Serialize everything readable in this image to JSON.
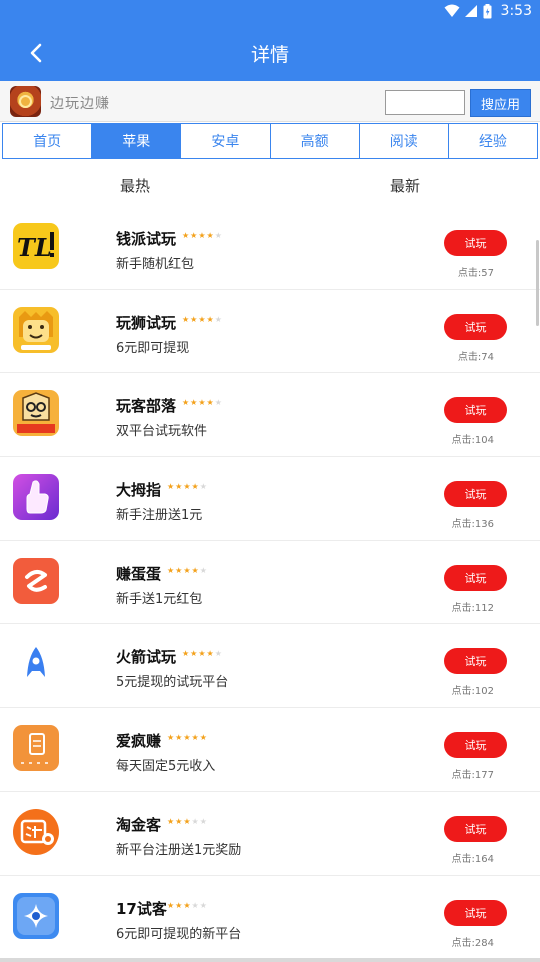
{
  "status_bar": {
    "time": "3:53"
  },
  "header": {
    "title": "详情"
  },
  "search": {
    "brand_text": "边玩边赚",
    "input_value": "",
    "button_label": "搜应用"
  },
  "tabs": [
    {
      "label": "首页",
      "active": false
    },
    {
      "label": "苹果",
      "active": true
    },
    {
      "label": "安卓",
      "active": false
    },
    {
      "label": "高额",
      "active": false
    },
    {
      "label": "阅读",
      "active": false
    },
    {
      "label": "经验",
      "active": false
    }
  ],
  "sort_tabs": {
    "hot": "最热",
    "new": "最新"
  },
  "apps": [
    {
      "name": "钱派试玩",
      "rating": 4,
      "desc": "新手随机红包",
      "button": "试玩",
      "clicks": "点击:57",
      "icon": "qianpai-icon"
    },
    {
      "name": "玩狮试玩",
      "rating": 4,
      "desc": "6元即可提现",
      "button": "试玩",
      "clicks": "点击:74",
      "icon": "lion-icon"
    },
    {
      "name": "玩客部落",
      "rating": 4,
      "desc": "双平台试玩软件",
      "button": "试玩",
      "clicks": "点击:104",
      "icon": "wanke-icon"
    },
    {
      "name": "大拇指",
      "rating": 4,
      "desc": "新手注册送1元",
      "button": "试玩",
      "clicks": "点击:136",
      "icon": "thumb-icon"
    },
    {
      "name": "赚蛋蛋",
      "rating": 4,
      "desc": "新手送1元红包",
      "button": "试玩",
      "clicks": "点击:112",
      "icon": "zhuandan-icon"
    },
    {
      "name": "火箭试玩",
      "rating": 4,
      "desc": "5元提现的试玩平台",
      "button": "试玩",
      "clicks": "点击:102",
      "icon": "rocket-icon"
    },
    {
      "name": "爱疯赚",
      "rating": 5,
      "desc": "每天固定5元收入",
      "button": "试玩",
      "clicks": "点击:177",
      "icon": "aifeng-icon"
    },
    {
      "name": "淘金客",
      "rating": 3,
      "desc": "新平台注册送1元奖励",
      "button": "试玩",
      "clicks": "点击:164",
      "icon": "taojin-icon"
    },
    {
      "name": "17试客",
      "rating": 3,
      "desc": "6元即可提现的新平台",
      "button": "试玩",
      "clicks": "点击:284",
      "icon": "shike17-icon"
    }
  ],
  "colors": {
    "primary": "#3a85ee",
    "button_red": "#ee1a1a",
    "star": "#f3a11b"
  }
}
